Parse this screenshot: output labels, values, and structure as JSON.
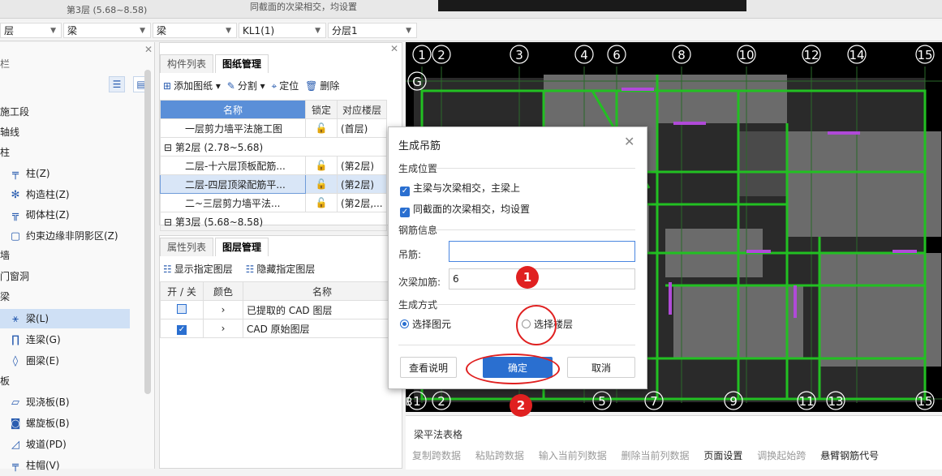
{
  "topstrip": {
    "prev_floor_text": "第3层 (5.68~8.58)",
    "checkbox_text": "同截面的次梁相交，均设置"
  },
  "selectors": {
    "floor": "层",
    "type": "梁",
    "subtype": "梁",
    "member": "KL1(1)",
    "layer": "分层1"
  },
  "left_panel": {
    "title": "栏",
    "items": [
      {
        "label": "施工段",
        "icon": ""
      },
      {
        "label": "轴线",
        "icon": ""
      },
      {
        "label": "柱",
        "icon": ""
      },
      {
        "label": "柱(Z)",
        "icon": "column-icon"
      },
      {
        "label": "构造柱(Z)",
        "icon": "constructional-column-icon"
      },
      {
        "label": "砌体柱(Z)",
        "icon": "masonry-column-icon"
      },
      {
        "label": "约束边缘非阴影区(Z)",
        "icon": "edge-zone-icon"
      },
      {
        "label": "墙",
        "icon": ""
      },
      {
        "label": "门窗洞",
        "icon": ""
      },
      {
        "label": "梁",
        "icon": ""
      },
      {
        "label": "梁(L)",
        "icon": "beam-icon"
      },
      {
        "label": "连梁(G)",
        "icon": "coupling-beam-icon"
      },
      {
        "label": "圈梁(E)",
        "icon": "ring-beam-icon"
      },
      {
        "label": "板",
        "icon": ""
      },
      {
        "label": "现浇板(B)",
        "icon": "cast-slab-icon"
      },
      {
        "label": "螺旋板(B)",
        "icon": "spiral-slab-icon"
      },
      {
        "label": "坡道(PD)",
        "icon": "ramp-icon"
      },
      {
        "label": "柱帽(V)",
        "icon": "column-cap-icon"
      }
    ]
  },
  "drawing_panel": {
    "tabs": [
      "构件列表",
      "图纸管理"
    ],
    "toolbar": {
      "add": "添加图纸",
      "split": "分割",
      "locate": "定位",
      "delete": "删除"
    },
    "headers": [
      "名称",
      "锁定",
      "对应楼层"
    ],
    "rows": [
      {
        "name": "一层剪力墙平法施工图",
        "floor": "(首层)",
        "group": false
      },
      {
        "name": "第2层 (2.78~5.68)",
        "floor": "",
        "group": true
      },
      {
        "name": "二层-十六层顶板配筋...",
        "floor": "(第2层)",
        "group": false
      },
      {
        "name": "二层-四层顶梁配筋平...",
        "floor": "(第2层)",
        "group": false,
        "selected": true
      },
      {
        "name": "二~三层剪力墙平法...",
        "floor": "(第2层,...",
        "group": false
      },
      {
        "name": "第3层 (5.68~8.58)",
        "floor": "",
        "group": true
      }
    ]
  },
  "layer_panel": {
    "tabs": [
      "属性列表",
      "图层管理"
    ],
    "toolbar": {
      "show": "显示指定图层",
      "hide": "隐藏指定图层"
    },
    "headers": [
      "开 / 关",
      "颜色",
      "名称"
    ],
    "rows": [
      {
        "name": "已提取的 CAD 图层",
        "on": false
      },
      {
        "name": "CAD 原始图层",
        "on": true
      }
    ]
  },
  "cad": {
    "top_axes": [
      "1",
      "2",
      "3",
      "4",
      "6",
      "8",
      "10",
      "12",
      "14",
      "15"
    ],
    "bottom_axes": [
      "1",
      "2",
      "5",
      "7",
      "9",
      "11",
      "13",
      "15"
    ],
    "row_axis_top": "G",
    "row_axis_bottom": "B"
  },
  "bottom_panel": {
    "title": "梁平法表格",
    "ops": [
      "复制跨数据",
      "粘贴跨数据",
      "输入当前列数据",
      "删除当前列数据",
      "页面设置",
      "调换起始跨",
      "悬臂钢筋代号"
    ]
  },
  "dialog": {
    "title": "生成吊筋",
    "section_position": "生成位置",
    "check1": "主梁与次梁相交，主梁上",
    "check2": "同截面的次梁相交，均设置",
    "section_rebar": "钢筋信息",
    "hanger_label": "吊筋:",
    "hanger_value": "",
    "secondary_label": "次梁加筋:",
    "secondary_value": "6",
    "section_method": "生成方式",
    "radio_select_element": "选择图元",
    "radio_select_floor": "选择楼层",
    "btn_help": "查看说明",
    "btn_ok": "确定",
    "btn_cancel": "取消"
  },
  "annotations": {
    "badge1": "1",
    "badge2": "2"
  },
  "colors": {
    "accent": "#2a6fd0",
    "annotation": "#e02020",
    "cad_bg": "#000000"
  }
}
